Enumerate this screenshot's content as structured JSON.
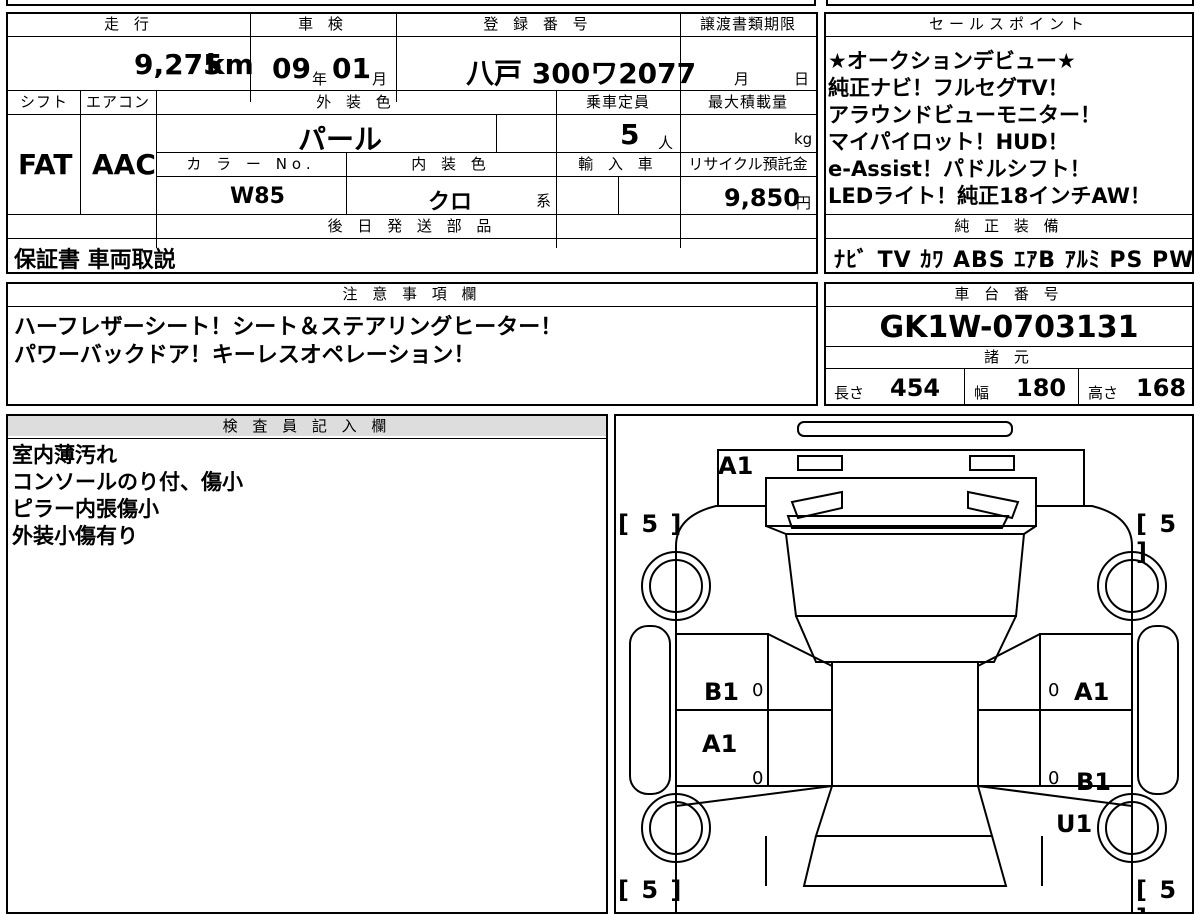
{
  "vehicle": {
    "headers": {
      "mileage": "走 行",
      "inspection": "車 検",
      "registration": "登 録 番 号",
      "transfer_deadline": "譲渡書類期限",
      "shift": "シフト",
      "aircon": "エアコン",
      "exterior_color": "外 装 色",
      "capacity": "乗車定員",
      "max_load": "最大積載量",
      "color_no": "カ ラ ー No.",
      "interior_color": "内 装 色",
      "import": "輸 入 車",
      "recycle_fee": "リサイクル預託金"
    },
    "mileage_value": "9,275",
    "mileage_unit": "km",
    "inspection_year": "09",
    "year_unit": "年",
    "inspection_month": "01",
    "month_unit": "月",
    "registration_number": "八戸 300ワ2077",
    "deadline_month_unit": "月",
    "deadline_day_unit": "日",
    "shift_value": "FAT",
    "aircon_value": "AAC",
    "exterior_color_value": "パール",
    "capacity_value": "5",
    "capacity_unit": "人",
    "max_load_unit": "kg",
    "color_no_value": "W85",
    "interior_color_value": "クロ",
    "interior_suffix": "系",
    "recycle_value": "9,850",
    "recycle_unit": "円"
  },
  "later_parts": {
    "header": "後 日 発 送 部 品",
    "value": "保証書 車両取説"
  },
  "sales_points": {
    "header": "セールスポイント",
    "lines": [
      "★オークションデビュー★",
      "純正ナビ！フルセグTV！",
      "アラウンドビューモニター！",
      "マイパイロット！HUD！",
      "e-Assist！パドルシフト！",
      "LEDライト！純正18インチAW！"
    ]
  },
  "equipment": {
    "header": "純 正 装 備",
    "value": "ﾅﾋﾞ TV ｶﾜ ABS ｴｱB ｱﾙﾐ PS PW"
  },
  "notes": {
    "header": "注 意 事 項 欄",
    "lines": [
      "ハーフレザーシート！シート＆ステアリングヒーター！",
      "パワーバックドア！キーレスオペレーション！"
    ]
  },
  "chassis": {
    "header": "車 台 番 号",
    "value": "GK1W-0703131"
  },
  "dimensions": {
    "header": "諸 元",
    "length_label": "長さ",
    "length_value": "454",
    "width_label": "幅",
    "width_value": "180",
    "height_label": "高さ",
    "height_value": "168"
  },
  "inspector": {
    "header": "検 査 員 記 入 欄",
    "lines": [
      "室内薄汚れ",
      "コンソールのり付、傷小",
      "ピラー内張傷小",
      "外装小傷有り"
    ]
  },
  "diagram": {
    "tire_marks": [
      "[ 5 ]",
      "[ 5 ]",
      "[ 5 ]",
      "[ 5 ]"
    ],
    "marks": {
      "rear_bumper": "A1",
      "left_rear_door": "B1",
      "left_front_door": "A1",
      "right_rear_door": "A1",
      "right_front_door": "B1",
      "right_front_fender": "U1"
    },
    "zeros": [
      "0",
      "0",
      "0",
      "0"
    ]
  }
}
